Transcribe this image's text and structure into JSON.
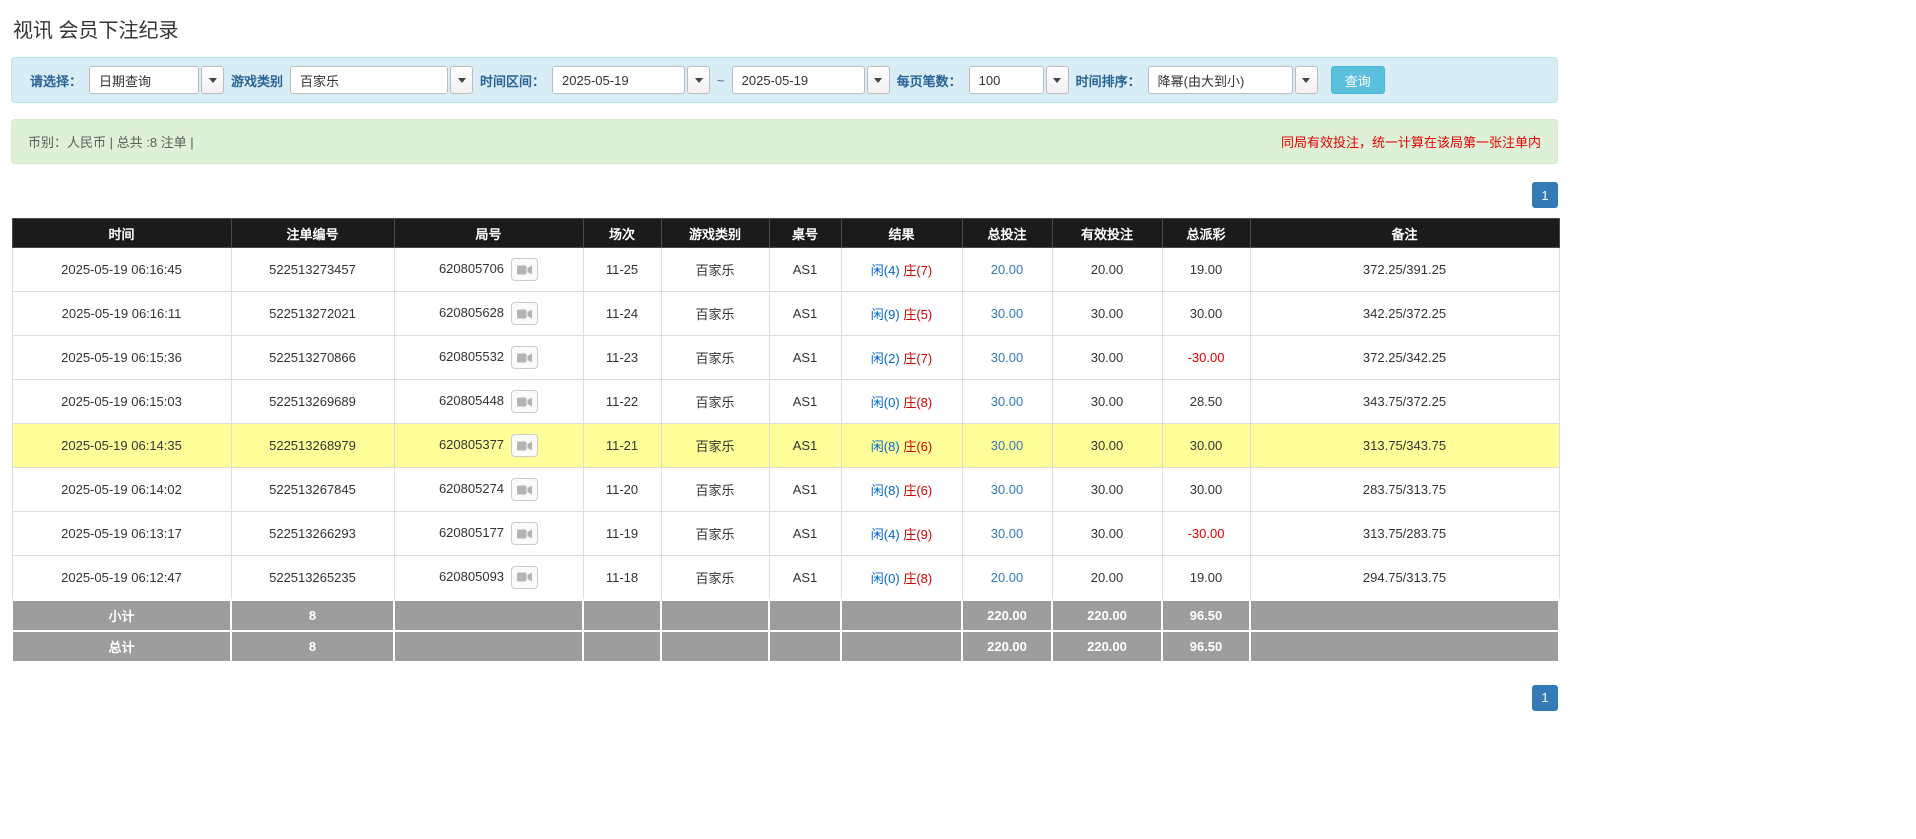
{
  "page": {
    "title": "视讯 会员下注纪录"
  },
  "filters": {
    "select_label": "请选择：",
    "select_value": "日期查询",
    "game_type_label": "游戏类别",
    "game_type_value": "百家乐",
    "time_range_label": "时间区间：",
    "date_from": "2025-05-19",
    "range_separator": "~",
    "date_to": "2025-05-19",
    "per_page_label": "每页笔数：",
    "per_page_value": "100",
    "sort_label": "时间排序：",
    "sort_value": "降幂(由大到小)",
    "search_button": "查询"
  },
  "summary": {
    "left": "币别：人民币 | 总共 :8 注单 |",
    "right": "同局有效投注，统一计算在该局第一张注单内"
  },
  "pagination": {
    "page": "1"
  },
  "table": {
    "headers": [
      "时间",
      "注单编号",
      "局号",
      "场次",
      "游戏类别",
      "桌号",
      "结果",
      "总投注",
      "有效投注",
      "总派彩",
      "备注"
    ],
    "rows": [
      {
        "time": "2025-05-19 06:16:45",
        "bet_id": "522513273457",
        "round": "620805706",
        "session": "11-25",
        "game": "百家乐",
        "table": "AS1",
        "result_player": "闲(4)",
        "result_banker": "庄(7)",
        "total_bet": "20.00",
        "valid_bet": "20.00",
        "payout": "19.00",
        "payout_negative": false,
        "note": "372.25/391.25",
        "highlighted": false
      },
      {
        "time": "2025-05-19 06:16:11",
        "bet_id": "522513272021",
        "round": "620805628",
        "session": "11-24",
        "game": "百家乐",
        "table": "AS1",
        "result_player": "闲(9)",
        "result_banker": "庄(5)",
        "total_bet": "30.00",
        "valid_bet": "30.00",
        "payout": "30.00",
        "payout_negative": false,
        "note": "342.25/372.25",
        "highlighted": false
      },
      {
        "time": "2025-05-19 06:15:36",
        "bet_id": "522513270866",
        "round": "620805532",
        "session": "11-23",
        "game": "百家乐",
        "table": "AS1",
        "result_player": "闲(2)",
        "result_banker": "庄(7)",
        "total_bet": "30.00",
        "valid_bet": "30.00",
        "payout": "-30.00",
        "payout_negative": true,
        "note": "372.25/342.25",
        "highlighted": false
      },
      {
        "time": "2025-05-19 06:15:03",
        "bet_id": "522513269689",
        "round": "620805448",
        "session": "11-22",
        "game": "百家乐",
        "table": "AS1",
        "result_player": "闲(0)",
        "result_banker": "庄(8)",
        "total_bet": "30.00",
        "valid_bet": "30.00",
        "payout": "28.50",
        "payout_negative": false,
        "note": "343.75/372.25",
        "highlighted": false
      },
      {
        "time": "2025-05-19 06:14:35",
        "bet_id": "522513268979",
        "round": "620805377",
        "session": "11-21",
        "game": "百家乐",
        "table": "AS1",
        "result_player": "闲(8)",
        "result_banker": "庄(6)",
        "total_bet": "30.00",
        "valid_bet": "30.00",
        "payout": "30.00",
        "payout_negative": false,
        "note": "313.75/343.75",
        "highlighted": true
      },
      {
        "time": "2025-05-19 06:14:02",
        "bet_id": "522513267845",
        "round": "620805274",
        "session": "11-20",
        "game": "百家乐",
        "table": "AS1",
        "result_player": "闲(8)",
        "result_banker": "庄(6)",
        "total_bet": "30.00",
        "valid_bet": "30.00",
        "payout": "30.00",
        "payout_negative": false,
        "note": "283.75/313.75",
        "highlighted": false
      },
      {
        "time": "2025-05-19 06:13:17",
        "bet_id": "522513266293",
        "round": "620805177",
        "session": "11-19",
        "game": "百家乐",
        "table": "AS1",
        "result_player": "闲(4)",
        "result_banker": "庄(9)",
        "total_bet": "30.00",
        "valid_bet": "30.00",
        "payout": "-30.00",
        "payout_negative": true,
        "note": "313.75/283.75",
        "highlighted": false
      },
      {
        "time": "2025-05-19 06:12:47",
        "bet_id": "522513265235",
        "round": "620805093",
        "session": "11-18",
        "game": "百家乐",
        "table": "AS1",
        "result_player": "闲(0)",
        "result_banker": "庄(8)",
        "total_bet": "20.00",
        "valid_bet": "20.00",
        "payout": "19.00",
        "payout_negative": false,
        "note": "294.75/313.75",
        "highlighted": false
      }
    ],
    "footer": {
      "subtotal": {
        "label": "小计",
        "count": "8",
        "total_bet": "220.00",
        "valid_bet": "220.00",
        "payout": "96.50"
      },
      "total": {
        "label": "总计",
        "count": "8",
        "total_bet": "220.00",
        "valid_bet": "220.00",
        "payout": "96.50"
      }
    }
  },
  "icons": {
    "video_replay": "video-replay-icon",
    "chevron_down": "chevron-down-icon"
  },
  "colors": {
    "accent_blue": "#337ab7",
    "player_blue": "#0066cc",
    "banker_red": "#cc0000",
    "negative_red": "#dd0000",
    "highlight_yellow": "#ffff99",
    "search_button_blue": "#5bc0de"
  }
}
